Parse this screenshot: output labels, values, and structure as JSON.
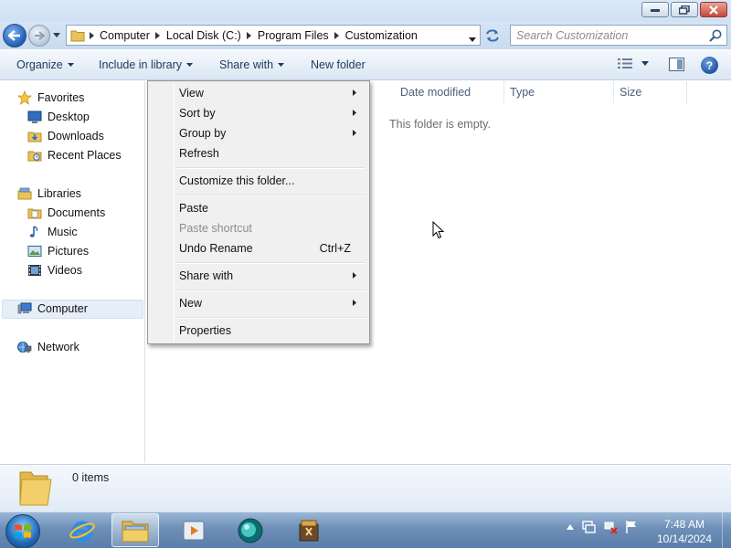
{
  "window": {
    "minimize_icon": "minimize-icon",
    "maximize_icon": "restore-icon",
    "close_icon": "close-icon"
  },
  "address": {
    "crumbs": [
      "Computer",
      "Local Disk (C:)",
      "Program Files",
      "Customization"
    ],
    "search_placeholder": "Search Customization"
  },
  "toolbar": {
    "organize": "Organize",
    "include_in_library": "Include in library",
    "share_with": "Share with",
    "new_folder": "New folder"
  },
  "navpane": {
    "favorites": "Favorites",
    "desktop": "Desktop",
    "downloads": "Downloads",
    "recent_places": "Recent Places",
    "libraries": "Libraries",
    "documents": "Documents",
    "music": "Music",
    "pictures": "Pictures",
    "videos": "Videos",
    "computer": "Computer",
    "network": "Network",
    "selected": "Computer"
  },
  "content": {
    "columns": [
      "Date modified",
      "Type",
      "Size"
    ],
    "empty_message": "This folder is empty."
  },
  "context_menu": {
    "items": [
      {
        "label": "View",
        "submenu": true
      },
      {
        "label": "Sort by",
        "submenu": true
      },
      {
        "label": "Group by",
        "submenu": true
      },
      {
        "label": "Refresh"
      },
      {
        "label": "Customize this folder..."
      },
      {
        "label": "Paste"
      },
      {
        "label": "Paste shortcut",
        "disabled": true
      },
      {
        "label": "Undo Rename",
        "shortcut": "Ctrl+Z"
      },
      {
        "label": "Share with",
        "submenu": true
      },
      {
        "label": "New",
        "submenu": true
      },
      {
        "label": "Properties"
      }
    ]
  },
  "details": {
    "item_count": "0 items"
  },
  "taskbar": {
    "pinned": [
      "internet-explorer-icon",
      "windows-explorer-icon",
      "media-player-icon",
      "messenger-icon",
      "archive-app-icon"
    ],
    "active": "windows-explorer-icon",
    "clock_time": "7:48 AM",
    "clock_date": "10/14/2024"
  },
  "colors": {
    "accent": "#1d5fb5",
    "menu_bg": "#f0f0f0",
    "toolbar_text": "#1e395b"
  }
}
